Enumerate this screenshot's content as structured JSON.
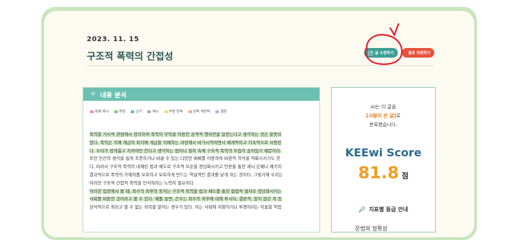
{
  "header": {
    "date": "2023. 11. 15",
    "title": "구조적 폭력의 간접성",
    "edit_label": "글 수정하기",
    "save_label": "결과 저장하기"
  },
  "panel": {
    "title": "내용 분석",
    "legend": [
      {
        "label": "화제 제시",
        "color": "#f08fb3"
      },
      {
        "label": "주장",
        "color": "#7bcf74"
      },
      {
        "label": "근거",
        "color": "#62b6e8"
      },
      {
        "label": "예시",
        "color": "#a9a9a9"
      },
      {
        "label": "주장 반박",
        "color": "#f3df5c"
      },
      {
        "label": "반박 재반박",
        "color": "#f5a97a"
      },
      {
        "label": "결론",
        "color": "#c7a3e6"
      }
    ],
    "lines": [
      {
        "text": "폭력을 거시적 관점에서 정의하여 폭력이 무력을 이용한 공격적 행위만을 일컫는다고 생각하는 것은 잘못되",
        "hl": true
      },
      {
        "text": "었다. 폭력은 지배 계급이 피지배 계급을 지배하는 과정에서 비가시적이면서 체계적이고 지속적으로 사용된",
        "hl": true
      },
      {
        "text": "다. 우리가 정의롭고 지켜야만 한다고 생각하는 법이나 절차 속에 구조적 폭력의 모습이 숨어있기 때문이다.",
        "hl": true
      },
      {
        "text": "또한 인간의 생각을 쉽게 조종하거나 바꿀 수 있는 다양한 매체를 이용하여 비판적 의식을 약화시키기도 한",
        "hl": false
      },
      {
        "text": "다. 따라서 구조적 폭력이 내재된 법과 제도로 구조적 모순을 정당화시키고 언론을 통한 세뇌 은폐나 왜곡이",
        "hl": false
      },
      {
        "text": "결과적으로 폭력의 가해자를 보호하고 보호하게 만드는 역설적인 결과를 낳게 하는 것이다. 그렇기에 우리는",
        "hl": false
      },
      {
        "text": "이러한 구조적·간접적 폭력을 인식하려는 노력이 필요하다.",
        "hl": false
      },
      {
        "text": "이러한 입장에서 볼 때, 최수의 최후의 동자는 구조적 폭력을 법과 제도를 통한 합법적 절차로 정당화시키는",
        "hl": true
      },
      {
        "text": "사회를 비판한 것이라고 볼 수 있다. 예를 들면, 간수는 최수의 최후에 대해 투시되, 결론적, 앞지 않은 죄 등",
        "hl": true
      },
      {
        "text": "상식적으로 죄라고 할 수 없는 죄목을 말하는 경우가 있다. 이는 사회에 저항하거나 투쟁하려는 이들을 억압",
        "hl": false
      }
    ]
  },
  "side": {
    "line1": "AI는 이 글을",
    "line2_highlight": "[사람이 쓴 글]",
    "line2_rest": "로",
    "line3": "분류했습니다.",
    "score_title": "KEEwi Score",
    "score_value": "81.8",
    "score_unit": "점",
    "guide_title": "지표별 등급 안내",
    "guide_item": "문법의 정확성"
  },
  "colors": {
    "accent": "#3a9e94",
    "save": "#e8513b",
    "score": "#f29d22",
    "panel_head": "#6cc0b3",
    "annotation": "#e0202a"
  }
}
